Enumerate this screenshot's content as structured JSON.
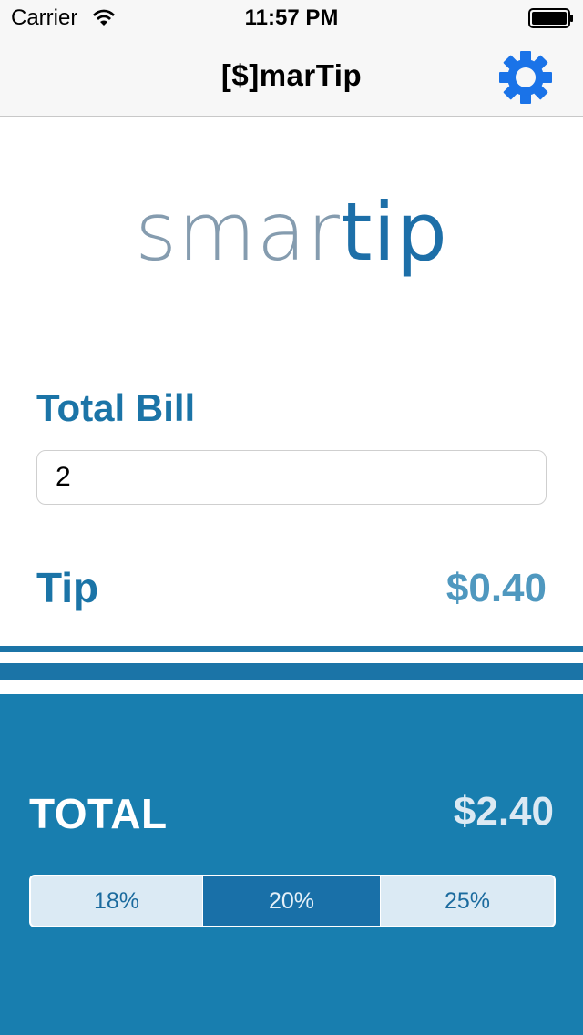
{
  "status_bar": {
    "carrier": "Carrier",
    "time": "11:57 PM",
    "wifi_icon": "wifi-icon",
    "battery_icon": "battery-icon"
  },
  "nav": {
    "title": "[$]marTip",
    "settings_icon": "gear-icon"
  },
  "logo": {
    "light_part": "smar",
    "bold_part": "tip"
  },
  "bill": {
    "label": "Total Bill",
    "value": "2"
  },
  "tip": {
    "label": "Tip",
    "amount": "$0.40"
  },
  "total": {
    "label": "TOTAL",
    "amount": "$2.40"
  },
  "tip_options": {
    "items": [
      "18%",
      "20%",
      "25%"
    ],
    "selected": "20%"
  },
  "colors": {
    "brand_blue": "#1b74a7",
    "panel_blue": "#187eaf",
    "selected_segment": "#1970a8",
    "settings_icon": "#1a73e8"
  }
}
